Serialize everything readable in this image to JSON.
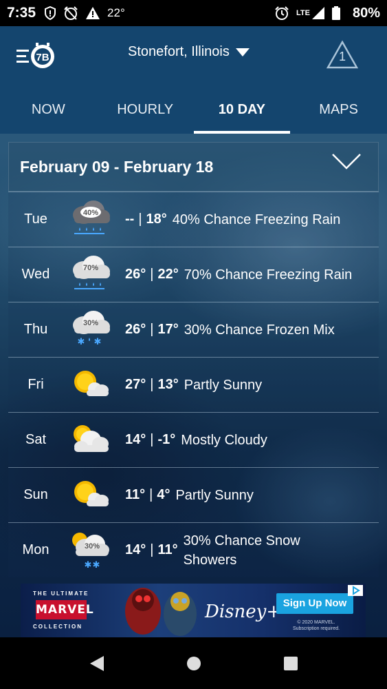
{
  "status_bar": {
    "time": "7:35",
    "temperature": "22°",
    "network": "LTE",
    "battery": "80%"
  },
  "header": {
    "location": "Stonefort, Illinois",
    "alert_count": "1"
  },
  "tabs": [
    {
      "label": "NOW",
      "active": false
    },
    {
      "label": "HOURLY",
      "active": false
    },
    {
      "label": "10 DAY",
      "active": true
    },
    {
      "label": "MAPS",
      "active": false
    }
  ],
  "forecast": {
    "range": "February 09 - February 18",
    "days": [
      {
        "day": "Tue",
        "high": "--",
        "low": "18°",
        "description": "40% Chance Freezing Rain",
        "icon": "freezing-rain-icon",
        "icon_pct": "40%"
      },
      {
        "day": "Wed",
        "high": "26°",
        "low": "22°",
        "description": "70% Chance Freezing Rain",
        "icon": "freezing-rain-icon",
        "icon_pct": "70%"
      },
      {
        "day": "Thu",
        "high": "26°",
        "low": "17°",
        "description": "30% Chance Frozen Mix",
        "icon": "frozen-mix-icon",
        "icon_pct": "30%"
      },
      {
        "day": "Fri",
        "high": "27°",
        "low": "13°",
        "description": "Partly Sunny",
        "icon": "partly-sunny-icon",
        "icon_pct": ""
      },
      {
        "day": "Sat",
        "high": "14°",
        "low": "-1°",
        "description": "Mostly Cloudy",
        "icon": "mostly-cloudy-icon",
        "icon_pct": ""
      },
      {
        "day": "Sun",
        "high": "11°",
        "low": "4°",
        "description": "Partly Sunny",
        "icon": "partly-sunny-icon",
        "icon_pct": ""
      },
      {
        "day": "Mon",
        "high": "14°",
        "low": "11°",
        "description": "30% Chance Snow Showers",
        "icon": "snow-showers-icon",
        "icon_pct": "30%"
      }
    ]
  },
  "ad": {
    "tagline_top": "THE ULTIMATE",
    "brand": "MARVEL",
    "tagline_bottom": "COLLECTION",
    "service": "Disney+",
    "cta": "Sign Up Now",
    "fine_print_1": "© 2020 MARVEL.",
    "fine_print_2": "Subscription required."
  }
}
